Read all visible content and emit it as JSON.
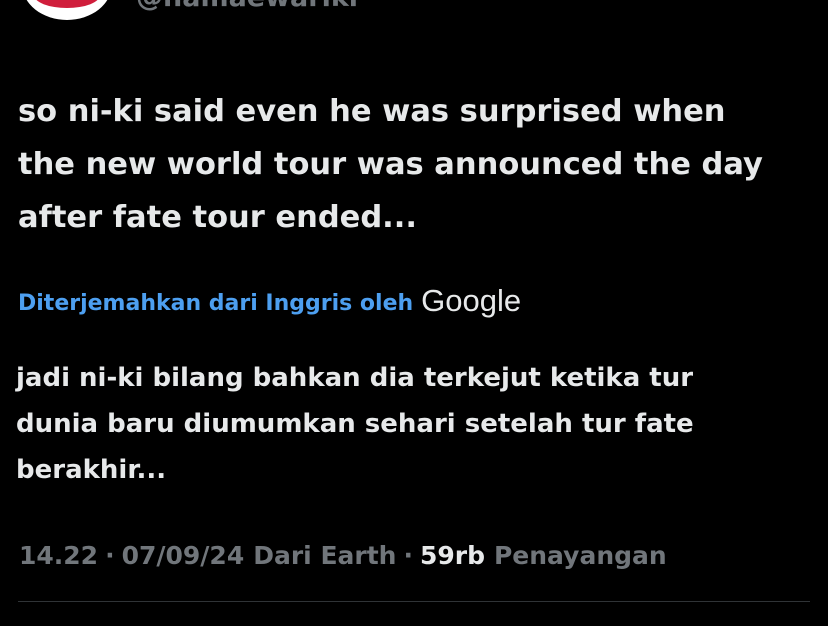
{
  "author": {
    "handle": "@namaewariki"
  },
  "tweet": {
    "lines": [
      "so ni-ki said even he was surprised when",
      "the new world tour was announced the day",
      "after fate tour ended..."
    ]
  },
  "translation": {
    "attribution": "Diterjemahkan dari Inggris oleh",
    "provider": "Google",
    "lines": [
      "jadi ni-ki bilang bahkan dia terkejut ketika tur",
      "dunia baru diumumkan sehari setelah tur fate",
      "berakhir..."
    ]
  },
  "meta": {
    "time": "14.22",
    "separator": "·",
    "date": "07/09/24",
    "source": "Dari Earth",
    "views_count": "59rb",
    "views_label": "Penayangan"
  },
  "colors": {
    "background": "#000000",
    "text_primary": "#e7e9ea",
    "text_secondary": "#71767b",
    "link": "#4d9ff0",
    "divider": "#2f3336"
  },
  "icons": {
    "avatar": "profile-avatar-image"
  }
}
